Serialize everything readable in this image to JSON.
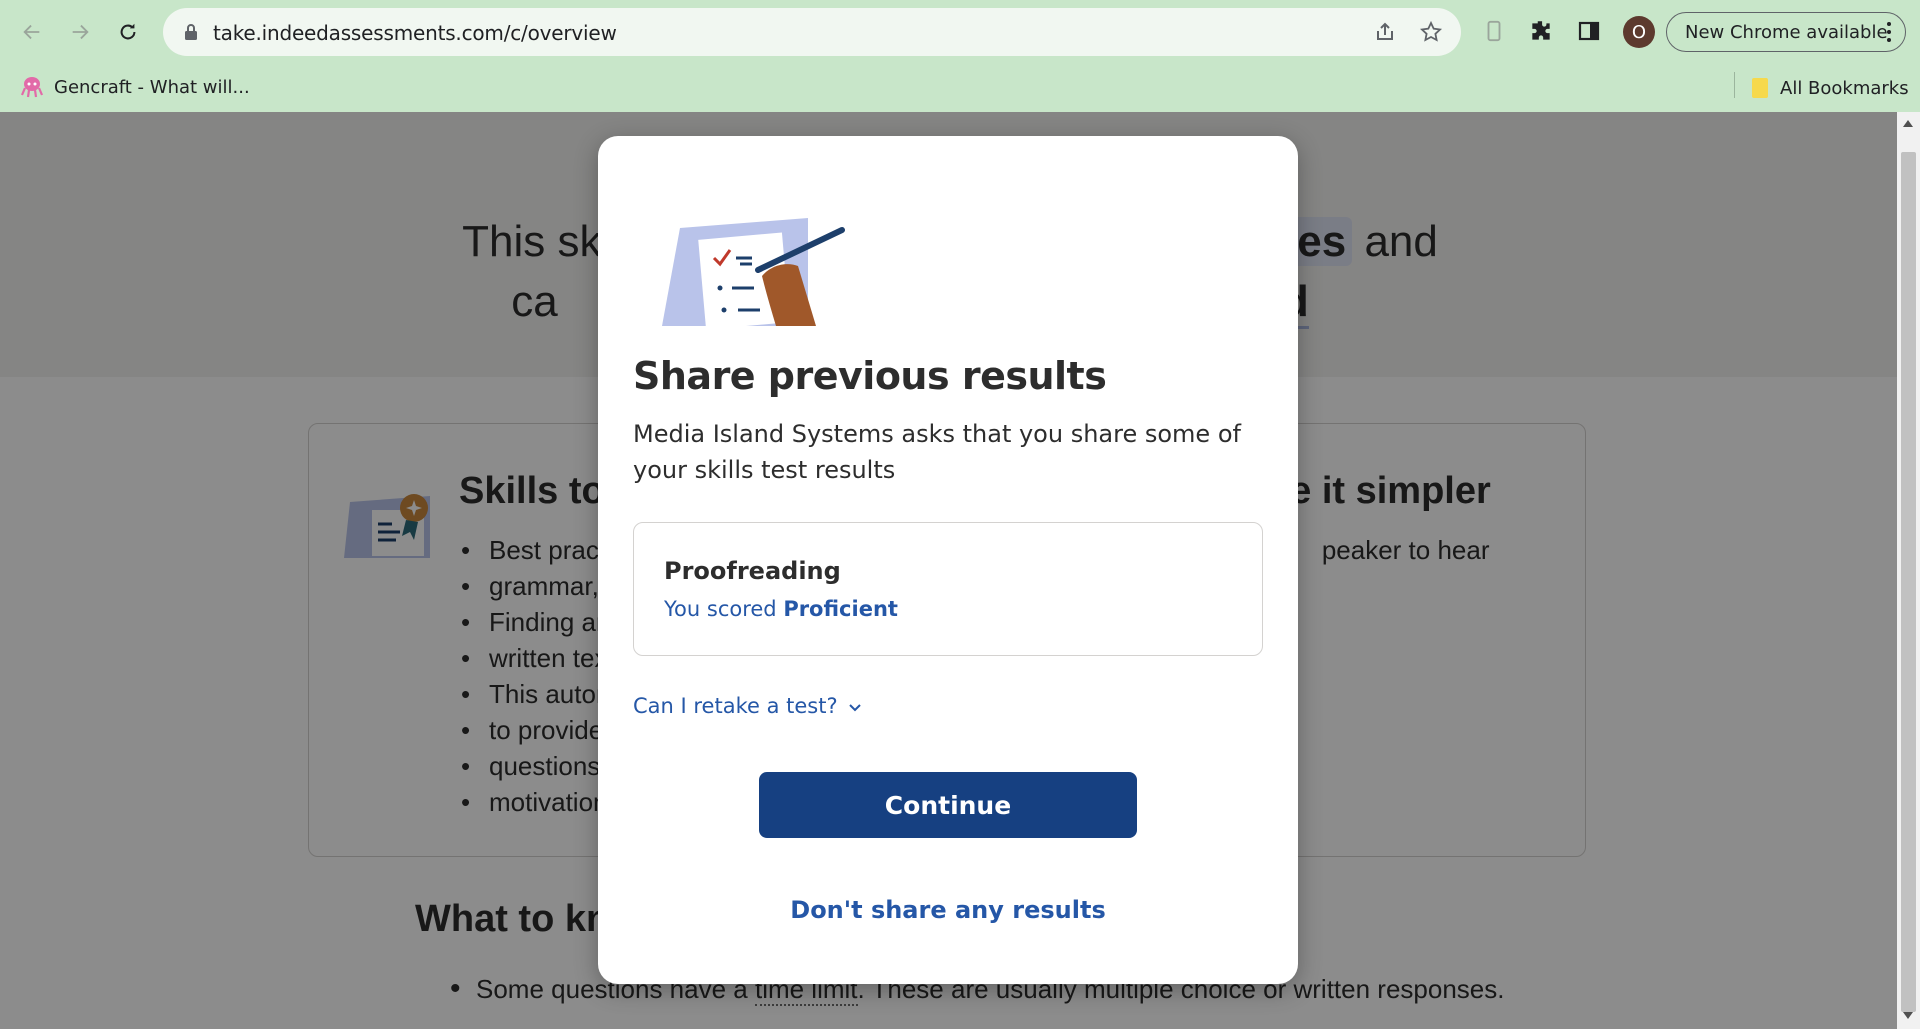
{
  "browser": {
    "url": "take.indeedassessments.com/c/overview",
    "profile_initial": "O",
    "update_label": "New Chrome available",
    "bookmarks": [
      {
        "label": "Gencraft - What will..."
      }
    ],
    "all_bookmarks_label": "All Bookmarks"
  },
  "page": {
    "hero_line1_a": "This ski",
    "hero_line1_b": "es",
    "hero_line1_c": " and",
    "hero_line2_a": "ca",
    "hero_line2_b": "wd",
    "card": {
      "title_left": "Skills to",
      "title_right": "ke it simpler",
      "bullets": [
        {
          "left": "Best practi",
          "right": "peaker to hear"
        },
        {
          "left": "grammar, s"
        },
        {
          "left": "Finding an"
        },
        {
          "left": "written tex"
        },
        {
          "left": "This autom"
        },
        {
          "left": "to provide"
        },
        {
          "left": "questions"
        },
        {
          "left": "motivation"
        }
      ]
    },
    "know": {
      "title": "What to kn",
      "bullet_a": "Some questions have a ",
      "bullet_link": "time limit",
      "bullet_b": ". These are usually multiple choice or written responses."
    }
  },
  "modal": {
    "title": "Share previous results",
    "description": "Media Island Systems asks that you share some of your skills test results",
    "result": {
      "name": "Proofreading",
      "score_prefix": "You scored ",
      "score_value": "Proficient"
    },
    "retake_label": "Can I retake a test?",
    "continue_label": "Continue",
    "dont_share_label": "Don't share any results"
  }
}
